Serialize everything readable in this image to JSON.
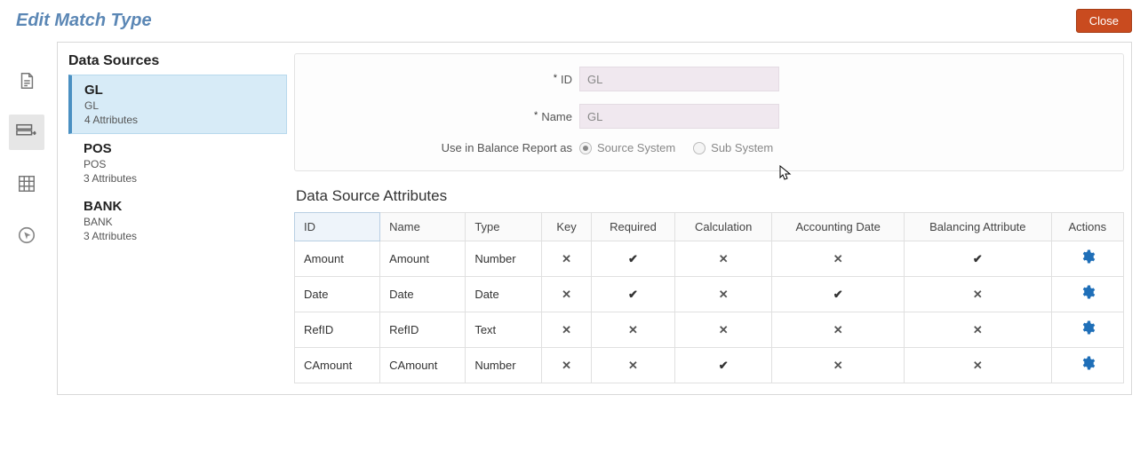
{
  "header": {
    "title": "Edit Match Type",
    "close_label": "Close"
  },
  "rail": {
    "icons": [
      "document-icon",
      "data-source-icon",
      "worksheet-icon",
      "pointer-icon"
    ]
  },
  "data_sources": {
    "header": "Data Sources",
    "items": [
      {
        "title": "GL",
        "sub": "GL",
        "meta": "4 Attributes",
        "selected": true
      },
      {
        "title": "POS",
        "sub": "POS",
        "meta": "3 Attributes",
        "selected": false
      },
      {
        "title": "BANK",
        "sub": "BANK",
        "meta": "3 Attributes",
        "selected": false
      }
    ]
  },
  "form": {
    "id_label": "ID",
    "id_value": "GL",
    "name_label": "Name",
    "name_value": "GL",
    "balance_label": "Use in Balance Report as",
    "opt_source": "Source System",
    "opt_sub": "Sub System"
  },
  "attributes": {
    "title": "Data Source Attributes",
    "columns": {
      "id": "ID",
      "name": "Name",
      "type": "Type",
      "key": "Key",
      "required": "Required",
      "calculation": "Calculation",
      "accounting_date": "Accounting Date",
      "balancing": "Balancing Attribute",
      "actions": "Actions"
    },
    "rows": [
      {
        "id": "Amount",
        "name": "Amount",
        "type": "Number",
        "key": false,
        "required": true,
        "calculation": false,
        "accounting_date": false,
        "balancing": true
      },
      {
        "id": "Date",
        "name": "Date",
        "type": "Date",
        "key": false,
        "required": true,
        "calculation": false,
        "accounting_date": true,
        "balancing": false
      },
      {
        "id": "RefID",
        "name": "RefID",
        "type": "Text",
        "key": false,
        "required": false,
        "calculation": false,
        "accounting_date": false,
        "balancing": false
      },
      {
        "id": "CAmount",
        "name": "CAmount",
        "type": "Number",
        "key": false,
        "required": false,
        "calculation": true,
        "accounting_date": false,
        "balancing": false
      }
    ]
  }
}
